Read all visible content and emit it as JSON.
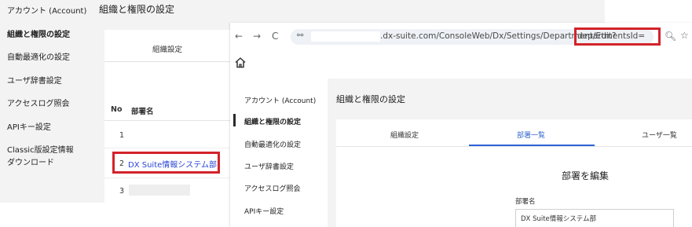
{
  "background_page": {
    "sidebar": {
      "items": [
        {
          "label": "アカウント (Account)"
        },
        {
          "label": "組織と権限の設定"
        },
        {
          "label": "自動最適化の設定"
        },
        {
          "label": "ユーザ辞書設定"
        },
        {
          "label": "アクセスログ照会"
        },
        {
          "label": "APIキー設定"
        },
        {
          "label": "Classic版設定情報"
        },
        {
          "label": "ダウンロード"
        }
      ]
    },
    "title": "組織と権限の設定",
    "tab_label": "組織設定",
    "table": {
      "headers": [
        "No",
        "部署名"
      ],
      "rows": [
        {
          "no": "1",
          "name": ""
        },
        {
          "no": "2",
          "name": "DX Suite情報システム部"
        },
        {
          "no": "3",
          "name": ""
        }
      ]
    }
  },
  "browser": {
    "url_domain_path": ".dx-suite.com/ConsoleWeb/Dx/Settings/Department/Edit?",
    "url_param": "departmentsId=",
    "icons": {
      "back": "←",
      "forward": "→",
      "reload": "C",
      "site_info": "⚯",
      "zoom": "🔍︎",
      "bookmark": "☆"
    }
  },
  "foreground_page": {
    "sidebar": {
      "items": [
        {
          "label": "アカウント (Account)"
        },
        {
          "label": "組織と権限の設定"
        },
        {
          "label": "自動最適化の設定"
        },
        {
          "label": "ユーザ辞書設定"
        },
        {
          "label": "アクセスログ照会"
        },
        {
          "label": "APIキー設定"
        }
      ]
    },
    "title": "組織と権限の設定",
    "tabs": [
      {
        "label": "組織設定"
      },
      {
        "label": "部署一覧"
      },
      {
        "label": "ユーザ一覧"
      }
    ],
    "heading": "部署を編集",
    "field_label": "部署名",
    "field_value": "DX Suite情報システム部"
  },
  "colors": {
    "highlight": "#d3232a",
    "link": "#2a46d6",
    "active_tab": "#2f63d8"
  }
}
